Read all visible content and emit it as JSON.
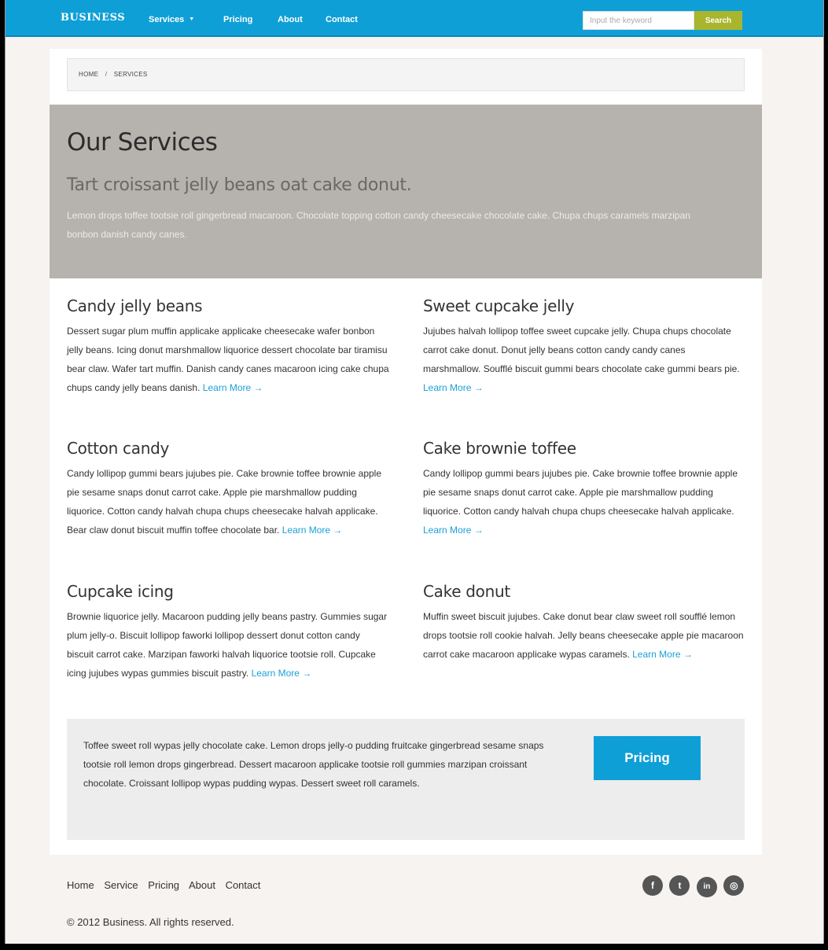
{
  "navbar": {
    "brand": "BUSINESS",
    "items": [
      {
        "label": "Services",
        "dropdown": true
      },
      {
        "label": "Pricing"
      },
      {
        "label": "About"
      },
      {
        "label": "Contact"
      }
    ],
    "search_placeholder": "Input the keyword",
    "search_label": "Search"
  },
  "breadcrumb": {
    "home": "HOME",
    "separator": "/",
    "current": "SERVICES"
  },
  "hero": {
    "title": "Our Services",
    "subtitle": "Tart croissant jelly beans oat cake donut.",
    "text": "Lemon drops toffee tootsie roll gingerbread macaroon. Chocolate topping cotton candy cheesecake chocolate cake. Chupa chups caramels marzipan bonbon danish candy canes."
  },
  "learn_more": "Learn More →",
  "services": [
    {
      "title": "Candy jelly beans",
      "text": "Dessert sugar plum muffin applicake applicake cheesecake wafer bonbon jelly beans. Icing donut marshmallow liquorice dessert chocolate bar tiramisu bear claw. Wafer tart muffin. Danish candy canes macaroon icing cake chupa chups candy jelly beans danish."
    },
    {
      "title": "Sweet cupcake jelly",
      "text": "Jujubes halvah lollipop toffee sweet cupcake jelly. Chupa chups chocolate carrot cake donut. Donut jelly beans cotton candy candy canes marshmallow. Soufflé biscuit gummi bears chocolate cake gummi bears pie."
    },
    {
      "title": "Cotton candy",
      "text": "Candy lollipop gummi bears jujubes pie. Cake brownie toffee brownie apple pie sesame snaps donut carrot cake. Apple pie marshmallow pudding liquorice. Cotton candy halvah chupa chups cheesecake halvah applicake. Bear claw donut biscuit muffin toffee chocolate bar."
    },
    {
      "title": "Cake brownie toffee",
      "text": "Candy lollipop gummi bears jujubes pie. Cake brownie toffee brownie apple pie sesame snaps donut carrot cake. Apple pie marshmallow pudding liquorice. Cotton candy halvah chupa chups cheesecake halvah applicake."
    },
    {
      "title": "Cupcake icing",
      "text": "Brownie liquorice jelly. Macaroon pudding jelly beans pastry. Gummies sugar plum jelly-o. Biscuit lollipop faworki lollipop dessert donut cotton candy biscuit carrot cake. Marzipan faworki halvah liquorice tootsie roll. Cupcake icing jujubes wypas gummies biscuit pastry."
    },
    {
      "title": "Cake donut",
      "text": "Muffin sweet biscuit jujubes. Cake donut bear claw sweet roll soufflé lemon drops tootsie roll cookie halvah. Jelly beans cheesecake apple pie macaroon carrot cake macaroon applicake wypas caramels."
    }
  ],
  "cta": {
    "text": "Toffee sweet roll wypas jelly chocolate cake. Lemon drops jelly-o pudding fruitcake gingerbread sesame snaps tootsie roll lemon drops gingerbread. Dessert macaroon applicake tootsie roll gummies marzipan croissant chocolate. Croissant lollipop wypas pudding wypas. Dessert sweet roll caramels.",
    "button": "Pricing"
  },
  "footer": {
    "links": [
      "Home",
      "Service",
      "Pricing",
      "About",
      "Contact"
    ],
    "copyright": "© 2012 Business. All rights reserved.",
    "social": [
      {
        "icon": "facebook-icon",
        "glyph": "f"
      },
      {
        "icon": "twitter-icon",
        "glyph": "t"
      },
      {
        "icon": "linkedin-icon",
        "glyph": "in"
      },
      {
        "icon": "rss-icon",
        "glyph": "◎"
      }
    ]
  },
  "colors": {
    "navbar": "#0f9fd7",
    "search_button": "#a9b52c",
    "hero_bg": "#b6b2ad",
    "link": "#1aa1d8",
    "page_bg": "#f6f3f1"
  }
}
